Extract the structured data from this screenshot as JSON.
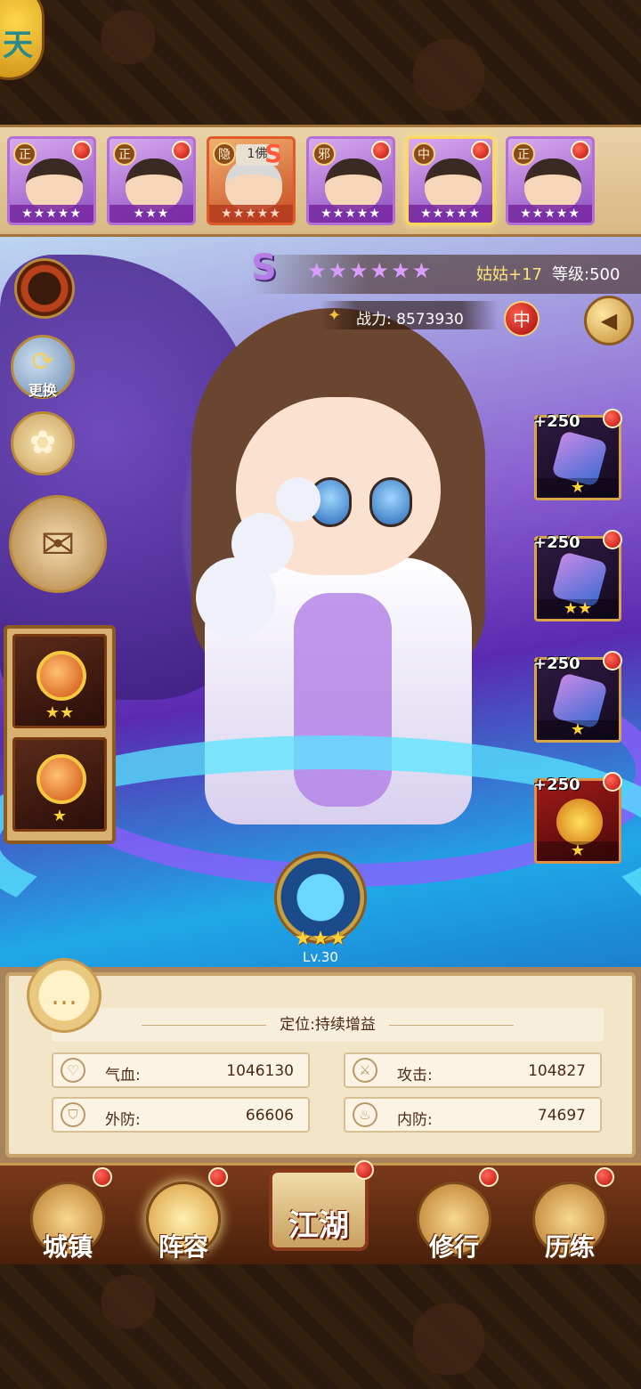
{
  "corner": {
    "glyph": "天"
  },
  "roster": [
    {
      "faction": "正",
      "stars": "★★★★★",
      "style": "purple",
      "hair": "dark",
      "badge": ""
    },
    {
      "faction": "正",
      "stars": "★★★",
      "style": "purple",
      "hair": "dark",
      "badge": ""
    },
    {
      "faction": "隐",
      "tag": "1佛",
      "stars": "★★★★★",
      "style": "orange",
      "hair": "grey",
      "badge": "S"
    },
    {
      "faction": "邪",
      "stars": "★★★★★",
      "style": "purple",
      "hair": "dark",
      "badge": ""
    },
    {
      "faction": "中",
      "stars": "★★★★★",
      "style": "selected",
      "hair": "dark",
      "badge": ""
    },
    {
      "faction": "正",
      "stars": "★★★★★",
      "style": "purple",
      "hair": "dark",
      "badge": ""
    }
  ],
  "hero": {
    "rank": "S",
    "rank_stars": "★★★★★★",
    "name": "姑姑+17",
    "level": "等级:500",
    "power_label": "战力:",
    "power_value": "8573930",
    "faction": "中"
  },
  "side": {
    "swap_label": "更换"
  },
  "accessories": [
    {
      "stars": "★★"
    },
    {
      "stars": "★"
    }
  ],
  "equipment": [
    {
      "bonus": "+250",
      "stars": "★"
    },
    {
      "bonus": "+250",
      "stars": "★★"
    },
    {
      "bonus": "+250",
      "stars": "★"
    },
    {
      "bonus": "+250",
      "stars": "★"
    }
  ],
  "skill": {
    "stars": "★★★",
    "level": "Lv.30"
  },
  "stats": {
    "role": "定位:持续增益",
    "hp_label": "气血:",
    "hp_value": "1046130",
    "atk_label": "攻击:",
    "atk_value": "104827",
    "pdef_label": "外防:",
    "pdef_value": "66606",
    "idef_label": "内防:",
    "idef_value": "74697"
  },
  "nav": {
    "town": "城镇",
    "lineup": "阵容",
    "jianghu": "江湖",
    "practice": "修行",
    "trials": "历练"
  },
  "colors": {
    "accent": "#ffd23a",
    "panel": "#f3e6c8",
    "alert": "#c0100a"
  }
}
